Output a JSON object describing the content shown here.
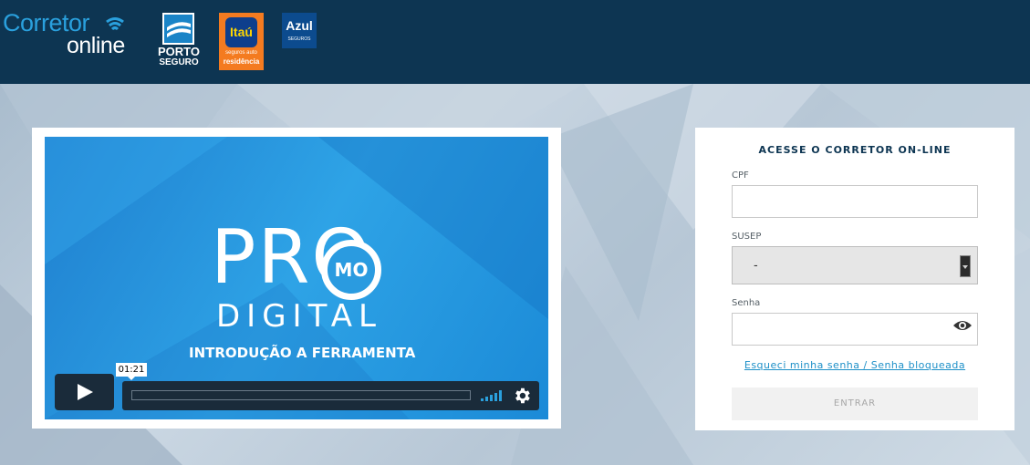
{
  "header": {
    "brand_line1": "Corretor",
    "brand_line2": "online",
    "porto_line1": "PORTO",
    "porto_line2": "SEGURO",
    "itau_name": "Itaú",
    "itau_line1": "seguros auto",
    "itau_line2": "residência",
    "azul_name": "Azul",
    "azul_sub": "SEGUROS",
    "colors": {
      "background": "#0d3552",
      "brand_blue": "#2aa0dd",
      "itau_orange": "#f47b20",
      "porto_blue": "#1a84c7",
      "azul_blue": "#0c4b8e"
    }
  },
  "video": {
    "title_pro": "PRO",
    "title_mo": "MO",
    "title_digital": "DIGITAL",
    "subtitle": "INTRODUÇÃO A FERRAMENTA",
    "time_tooltip": "01:21",
    "icons": {
      "play": "play-icon",
      "volume": "volume-icon",
      "settings": "gear-icon"
    }
  },
  "login": {
    "title": "ACESSE O CORRETOR ON-LINE",
    "cpf_label": "CPF",
    "cpf_value": "",
    "susep_label": "SUSEP",
    "susep_value": "-",
    "password_label": "Senha",
    "password_value": "",
    "forgot_link": "Esqueci minha senha / Senha bloqueada",
    "submit_label": "ENTRAR",
    "icons": {
      "show_password": "eye-icon"
    }
  }
}
